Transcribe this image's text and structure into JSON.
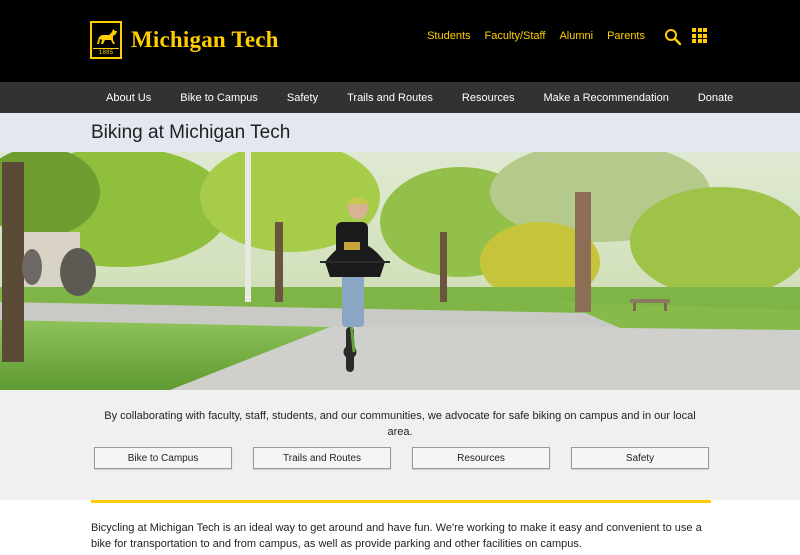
{
  "header": {
    "brand": "Michigan Tech",
    "logo_year": "1885",
    "audience_links": [
      "Students",
      "Faculty/Staff",
      "Alumni",
      "Parents"
    ],
    "accent_color": "#ffcd00"
  },
  "nav": {
    "items": [
      "About Us",
      "Bike to Campus",
      "Safety",
      "Trails and Routes",
      "Resources",
      "Make a Recommendation",
      "Donate"
    ]
  },
  "page": {
    "title": "Biking at Michigan Tech"
  },
  "intro": {
    "text": "By collaborating with faculty, staff, students, and our communities, we advocate for safe biking on campus and in our local area.",
    "buttons": [
      "Bike to Campus",
      "Trails and Routes",
      "Resources",
      "Safety"
    ]
  },
  "content": {
    "paragraph": "Bicycling at Michigan Tech is an ideal way to get around and have fun. We're working to make it easy and convenient to use a bike for transportation to and from campus, as well as provide parking and other facilities on campus."
  },
  "icons": {
    "search": "search-icon",
    "apps": "grid-icon",
    "logo": "husky-logo-icon"
  }
}
